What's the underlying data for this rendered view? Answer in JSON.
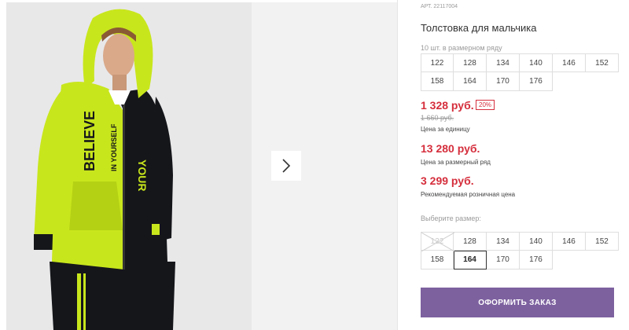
{
  "product": {
    "article_label": "АРТ. 22117004",
    "title": "Толстовка для мальчика",
    "sizes_in_row_caption": "10 шт. в размерном ряду",
    "row_sizes": [
      "122",
      "128",
      "134",
      "140",
      "146",
      "152",
      "158",
      "164",
      "170",
      "176"
    ]
  },
  "pricing": {
    "unit_price": "1 328 руб.",
    "discount": "20%",
    "old_price": "1 660 руб.",
    "unit_price_note": "Цена за единицу",
    "row_price": "13 280 руб.",
    "row_price_note": "Цена за размерный ряд",
    "retail_price": "3 299 руб.",
    "retail_price_note": "Рекомендуемая розничная цена"
  },
  "size_picker": {
    "caption": "Выберите размер:",
    "options": [
      {
        "label": "122",
        "available": false
      },
      {
        "label": "128",
        "available": true
      },
      {
        "label": "134",
        "available": true
      },
      {
        "label": "140",
        "available": true
      },
      {
        "label": "146",
        "available": true
      },
      {
        "label": "152",
        "available": true
      },
      {
        "label": "158",
        "available": true
      },
      {
        "label": "164",
        "available": true,
        "selected": true
      },
      {
        "label": "170",
        "available": true
      },
      {
        "label": "176",
        "available": true
      }
    ]
  },
  "actions": {
    "order_label": "ОФОРМИТЬ ЗАКАЗ"
  },
  "gallery": {
    "next_icon": "chevron-right-icon",
    "hoodie_print": [
      "BELIEVE",
      "IN YOURSELF",
      "YOUR"
    ]
  },
  "colors": {
    "accent": "#7d619f",
    "price": "#d52e3c",
    "hoodie_lime": "#c8e61c",
    "hoodie_black": "#15161a"
  }
}
